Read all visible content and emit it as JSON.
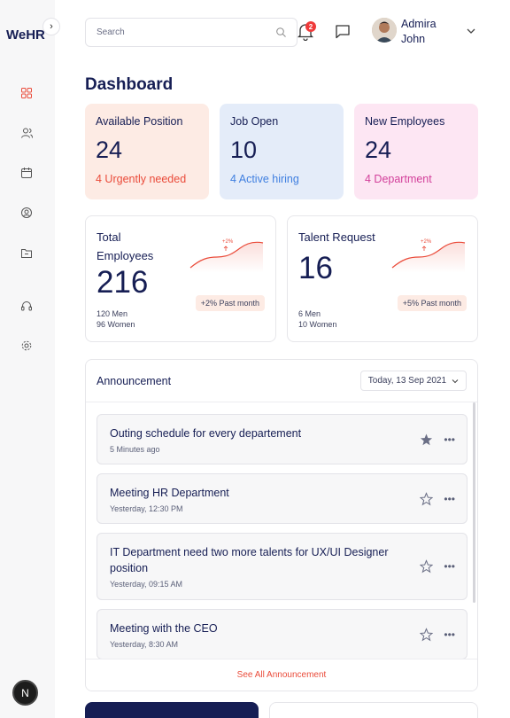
{
  "brand": "WeHR",
  "sidebar": {
    "avatar_initial": "N",
    "icons": [
      "dashboard-icon",
      "users-icon",
      "calendar-icon",
      "profile-icon",
      "folder-icon",
      "headset-icon",
      "settings-icon"
    ]
  },
  "header": {
    "search_placeholder": "Search",
    "notification_count": "2",
    "user_name": "Admira John"
  },
  "page_title": "Dashboard",
  "stats": [
    {
      "label": "Available Position",
      "value": "24",
      "sub": "4 Urgently needed"
    },
    {
      "label": "Job Open",
      "value": "10",
      "sub": "4 Active hiring"
    },
    {
      "label": "New Employees",
      "value": "24",
      "sub": "4 Department"
    }
  ],
  "cards": [
    {
      "label": "Total Employees",
      "value": "216",
      "spark_label": "+2%",
      "pill": "+2% Past month",
      "meta_1": "120 Men",
      "meta_2": "96 Women"
    },
    {
      "label": "Talent Request",
      "value": "16",
      "spark_label": "+2%",
      "pill": "+5% Past month",
      "meta_1": "6 Men",
      "meta_2": "10 Women"
    }
  ],
  "announcement": {
    "title": "Announcement",
    "date_filter": "Today, 13 Sep 2021",
    "items": [
      {
        "title": "Outing schedule for every departement",
        "time": "5 Minutes ago",
        "starred": true
      },
      {
        "title": "Meeting HR Department",
        "time": "Yesterday, 12:30 PM",
        "starred": false
      },
      {
        "title": "IT Department need two more talents for UX/UI Designer position",
        "time": "Yesterday, 09:15 AM",
        "starred": false
      },
      {
        "title": "Meeting with the CEO",
        "time": "Yesterday, 8:30 AM",
        "starred": false
      }
    ],
    "footer_link": "See All Announcement"
  },
  "colors": {
    "navy": "#161e54",
    "accent_red": "#ea4b3a",
    "accent_blue": "#3f7fe0",
    "accent_pink": "#d23f9a"
  }
}
